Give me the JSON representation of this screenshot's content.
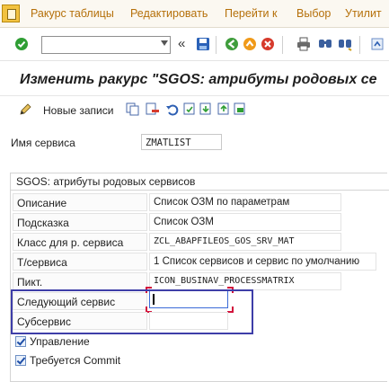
{
  "menu": {
    "items": [
      "Ракурс таблицы",
      "Редактировать",
      "Перейти к",
      "Выбор",
      "Утилит"
    ]
  },
  "toolbar": {
    "command_value": "",
    "icons": [
      "enter-icon",
      "command-dropdown-icon",
      "back-double-icon",
      "save-icon",
      "back-icon",
      "exit-icon",
      "cancel-icon",
      "print-icon",
      "find-icon",
      "find-next-icon"
    ]
  },
  "title": "Изменить ракурс \"SGOS: атрибуты родовых се",
  "app_toolbar": {
    "new_entries": "Новые записи"
  },
  "service": {
    "label": "Имя сервиса",
    "value": "ZMATLIST"
  },
  "group": {
    "title": "SGOS: атрибуты родовых сервисов",
    "rows": [
      {
        "label": "Описание",
        "value": "Список ОЗМ по параметрам"
      },
      {
        "label": "Подсказка",
        "value": "Список ОЗМ"
      },
      {
        "label": "Класс для р. сервиса",
        "value": "ZCL_ABAPFILEOS_GOS_SRV_MAT"
      },
      {
        "label": "Т/сервиса",
        "value": "1 Список сервисов и сервис по умолчанию"
      },
      {
        "label": "Пикт.",
        "value": "ICON_BUSINAV_PROCESSMATRIX"
      },
      {
        "label": "Следующий сервис",
        "value": ""
      },
      {
        "label": "Субсервис",
        "value": ""
      }
    ],
    "checkboxes": [
      {
        "label": "Управление",
        "checked": true
      },
      {
        "label": "Требуется Commit",
        "checked": true
      }
    ]
  },
  "colors": {
    "menu_text": "#b5700a",
    "highlight_border": "#3e3ea8",
    "focus_border": "#3b6bd8"
  }
}
